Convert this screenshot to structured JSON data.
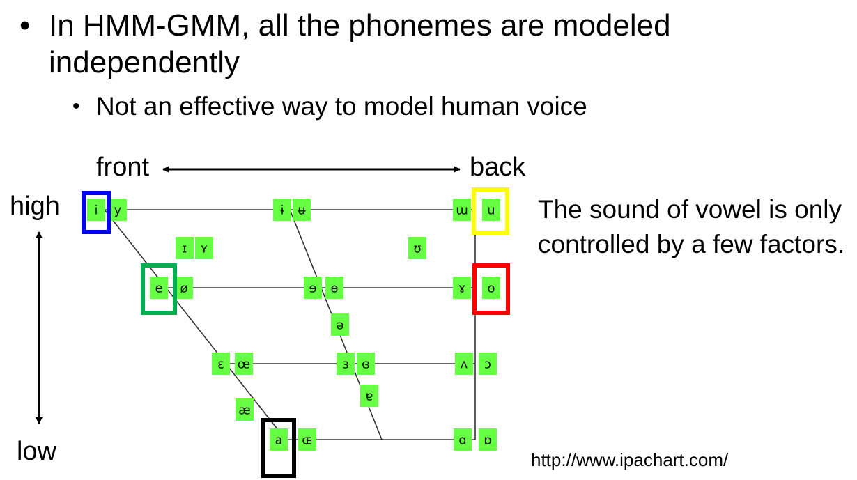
{
  "bullets": {
    "main_text": "In HMM-GMM, all the phonemes are modeled independently",
    "sub_text": "Not an effective way to model human voice"
  },
  "axis_labels": {
    "front": "front",
    "back": "back",
    "high": "high",
    "low": "low"
  },
  "side_text": "The sound of vowel is only controlled by a few factors.",
  "url": "http://www.ipachart.com/",
  "vowels": [
    "i",
    "y",
    "ɨ",
    "ʉ",
    "ɯ",
    "u",
    "ɪ",
    "ʏ",
    "ʊ",
    "e",
    "ø",
    "ɘ",
    "ɵ",
    "ɤ",
    "o",
    "ə",
    "ɛ",
    "œ",
    "ɜ",
    "ɞ",
    "ʌ",
    "ɔ",
    "æ",
    "ɐ",
    "a",
    "ɶ",
    "ɑ",
    "ɒ"
  ],
  "highlights": [
    {
      "vowel": "i",
      "color": "#0000ff"
    },
    {
      "vowel": "u",
      "color": "#ffff00"
    },
    {
      "vowel": "e",
      "color": "#00b050"
    },
    {
      "vowel": "o",
      "color": "#ff0000"
    },
    {
      "vowel": "a",
      "color": "#000000"
    }
  ],
  "colors": {
    "vowel_box": "#66ff44",
    "grid_line": "#333333"
  }
}
